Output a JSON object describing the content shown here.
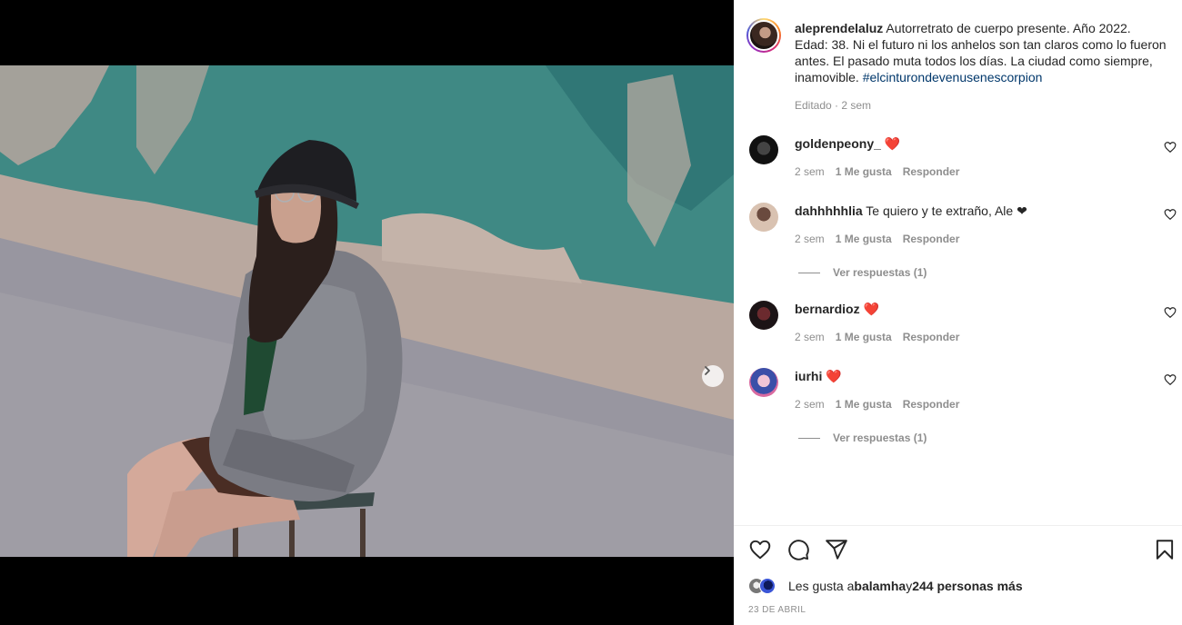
{
  "post": {
    "author": "aleprendelaluz",
    "caption": " Autorretrato de cuerpo presente. Año 2022. Edad: 38. Ni el futuro ni los anhelos son tan claros como lo fueron antes. El pasado muta todos los días. La ciudad como siempre, inamovible. ",
    "hashtag": "#elcinturondevenusenescorpion",
    "meta": "Editado · 2 sem",
    "carousel_count": 2,
    "carousel_active": 1
  },
  "comments": [
    {
      "user": "goldenpeony_",
      "text": " ❤️",
      "time": "2 sem",
      "likes": "1 Me gusta",
      "reply": "Responder",
      "view_replies": ""
    },
    {
      "user": "dahhhhhlia",
      "text": " Te quiero y te extraño, Ale ❤",
      "time": "2 sem",
      "likes": "1 Me gusta",
      "reply": "Responder",
      "view_replies": "Ver respuestas (1)"
    },
    {
      "user": "bernardioz",
      "text": " ❤️",
      "time": "2 sem",
      "likes": "1 Me gusta",
      "reply": "Responder",
      "view_replies": ""
    },
    {
      "user": "iurhi",
      "text": " ❤️",
      "time": "2 sem",
      "likes": "1 Me gusta",
      "reply": "Responder",
      "view_replies": "Ver respuestas (1)"
    }
  ],
  "likes": {
    "prefix": "Les gusta a ",
    "user": "balamha",
    "middle": " y ",
    "others": "244 personas más"
  },
  "date": "23 DE ABRIL",
  "icons": {
    "like": "heart-icon",
    "comment": "comment-icon",
    "share": "send-icon",
    "save": "bookmark-icon",
    "next": "chevron-right-icon"
  },
  "colors": {
    "text": "#262626",
    "secondary": "#8e8e8e",
    "hashtag": "#00376b",
    "heart": "#ed4956"
  }
}
